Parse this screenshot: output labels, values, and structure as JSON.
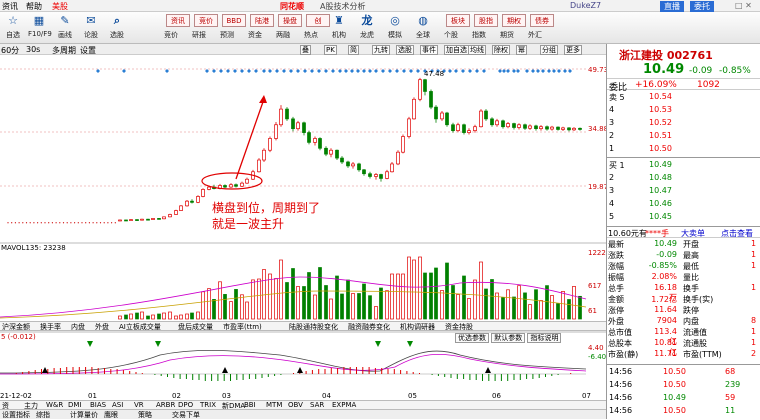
{
  "menu": {
    "items": [
      "资讯",
      "帮助",
      "美股"
    ],
    "app_title": "A股技术分析",
    "user": "DukeZ7",
    "right_buttons": [
      "直播",
      "委托"
    ]
  },
  "toolbar": {
    "items": [
      "自选",
      "F10/F9",
      "画线",
      "论股",
      "选股",
      "竞价",
      "研报",
      "预测",
      "资金",
      "两融",
      "热点",
      "机构",
      "龙虎",
      "模拟",
      "全球",
      "个股",
      "指数",
      "期货",
      "外汇"
    ],
    "special": [
      "资讯",
      "竞价",
      "BBD",
      "陆港",
      "操盘",
      "创",
      "板块",
      "股指",
      "期权",
      "债券",
      "更多",
      "多窗"
    ]
  },
  "chartbar": {
    "period": "60分",
    "interval": "30s",
    "labels": [
      "多周期",
      "设置"
    ],
    "buttons": [
      "叠",
      "PK",
      "简",
      "九转",
      "选股",
      "事件",
      "加自选",
      "均线",
      "除权",
      "幂",
      "分组",
      "更多"
    ]
  },
  "main_chart": {
    "price_labels": [
      "49.73",
      "34.88",
      "19.87"
    ],
    "high_label": "47.48",
    "annotation_line1": "横盘到位，周期到了",
    "annotation_line2": "就是一波主升",
    "colors": {
      "up": "#e00000",
      "down": "#008000",
      "annotation": "#e00000",
      "diamond": "#2a7fd4",
      "ma": "#c8a000"
    }
  },
  "volume": {
    "label": "MAVOL135: 23238",
    "axis": [
      "1222",
      "617",
      "61"
    ]
  },
  "tabs": {
    "items": [
      "沪深金额",
      "换手率",
      "内盘",
      "外盘",
      "AI立板成交量",
      "盘后成交量",
      "市盈率(ttm)",
      "陆股通持股变化",
      "融资融券变化",
      "机构调研器",
      "资金持股"
    ]
  },
  "indicator": {
    "label": "5 (-0.012)",
    "buttons": [
      "优选参数",
      "默认参数",
      "指标说明"
    ],
    "axis": [
      "4.40",
      "-6.40"
    ],
    "dates": [
      "21-12-02",
      "01",
      "02",
      "03",
      "04",
      "05",
      "06",
      "07"
    ]
  },
  "indicator_tabs": [
    "资",
    "主力",
    "W&R",
    "DMI",
    "BIAS",
    "ASI",
    "VR",
    "ARBR",
    "DPO",
    "TRIX",
    "新DMA",
    "BBI",
    "MTM",
    "OBV",
    "SAR",
    "EXPMA"
  ],
  "statusbar": {
    "items": [
      "设置指标",
      "综指",
      "计算量价",
      "鹰眼",
      "策略",
      "交易下单"
    ]
  },
  "stock": {
    "name": "浙江建投",
    "code": "002761",
    "price": "10.49",
    "change": "-0.09",
    "pct": "-0.85%",
    "weibi_label": "委比",
    "weibi": "+16.09%",
    "weicha": "1092",
    "sell": [
      {
        "label": "卖 5",
        "price": "10.54"
      },
      {
        "label": "4",
        "price": "10.53"
      },
      {
        "label": "3",
        "price": "10.52"
      },
      {
        "label": "2",
        "price": "10.51"
      },
      {
        "label": "1",
        "price": "10.50"
      }
    ],
    "buy": [
      {
        "label": "买 1",
        "price": "10.49"
      },
      {
        "label": "2",
        "price": "10.48"
      },
      {
        "label": "3",
        "price": "10.47"
      },
      {
        "label": "4",
        "price": "10.46"
      },
      {
        "label": "5",
        "price": "10.45"
      }
    ],
    "info_header": [
      "10.60元有",
      "****手",
      "大卖单",
      "点击查看"
    ],
    "info_left": [
      [
        "最新",
        "10.49"
      ],
      [
        "涨跌",
        "-0.09"
      ],
      [
        "涨幅",
        "-0.85%"
      ],
      [
        "振幅",
        "2.08%"
      ],
      [
        "总手",
        "16.18万"
      ],
      [
        "金额",
        "1.72亿"
      ],
      [
        "涨停",
        "11.64"
      ],
      [
        "外盘",
        "7904"
      ],
      [
        "总市值",
        "113.4亿"
      ],
      [
        "总股本",
        "10.81亿"
      ],
      [
        "市盈(静)",
        "11.71"
      ]
    ],
    "info_right": [
      [
        "开盘",
        "1"
      ],
      [
        "最高",
        "1"
      ],
      [
        "最低",
        "1"
      ],
      [
        "量比",
        ""
      ],
      [
        "换手",
        "1"
      ],
      [
        "换手(实)",
        ""
      ],
      [
        "跌停",
        ""
      ],
      [
        "内盘",
        "8"
      ],
      [
        "流通值",
        "1"
      ],
      [
        "流通股",
        "1"
      ],
      [
        "市盈(TTM)",
        "2"
      ]
    ],
    "ticks": [
      [
        "14:56",
        "10.50",
        "68"
      ],
      [
        "14:56",
        "10.50",
        "239"
      ],
      [
        "14:56",
        "10.49",
        "59"
      ],
      [
        "14:56",
        "10.50",
        "11"
      ]
    ]
  }
}
